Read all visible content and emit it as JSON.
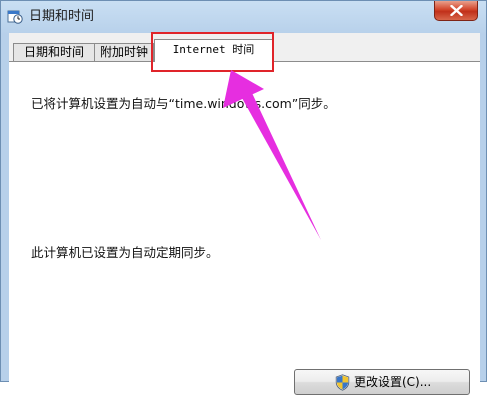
{
  "window": {
    "title": "日期和时间",
    "close_icon": "close-icon"
  },
  "tabs": [
    {
      "label": "日期和时间",
      "active": false
    },
    {
      "label": "附加时钟",
      "active": false
    },
    {
      "label": "Internet 时间",
      "active": true
    }
  ],
  "panel": {
    "sync_status": "已将计算机设置为自动与“time.windows.com”同步。",
    "auto_sync_note": "此计算机已设置为自动定期同步。"
  },
  "buttons": {
    "change_settings_label": "更改设置(C)...",
    "change_settings_icon": "uac-shield-icon"
  },
  "annotation": {
    "highlight_color": "#e0242a",
    "arrow_color": "#e62ee0",
    "arrow_icon": "pointer-arrow-icon"
  }
}
